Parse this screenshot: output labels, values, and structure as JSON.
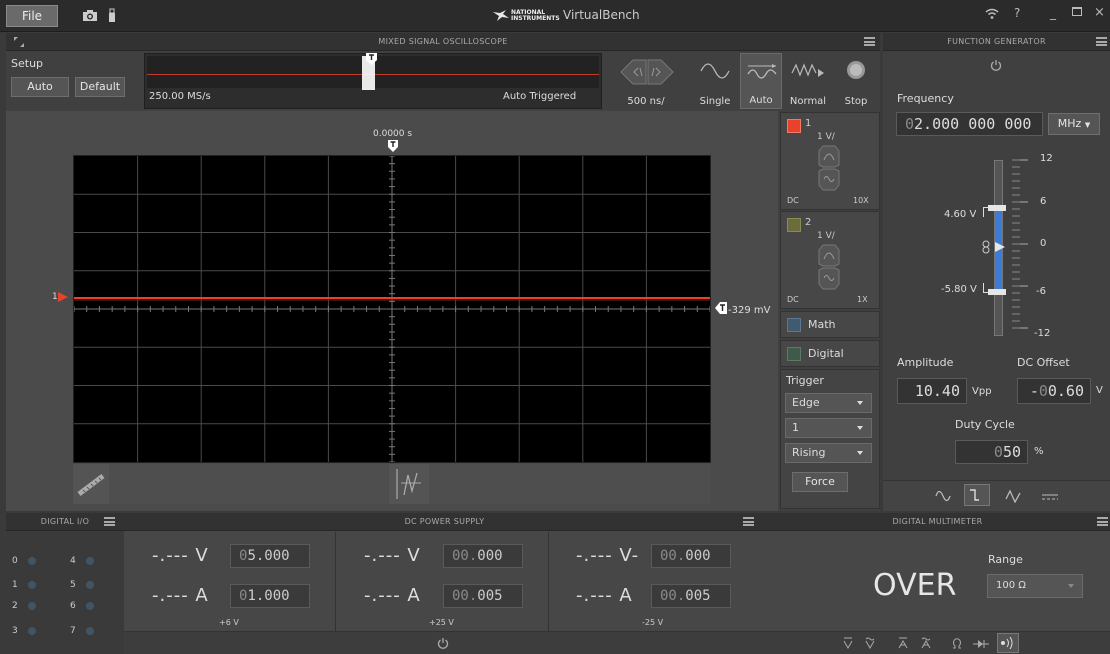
{
  "titlebar": {
    "file_label": "File",
    "app_title": "VirtualBench",
    "logo_text_top": "NATIONAL",
    "logo_text_bottom": "INSTRUMENTS",
    "help": "?",
    "minimize": "_",
    "close": "×"
  },
  "scope": {
    "title": "MIXED SIGNAL OSCILLOSCOPE",
    "setup_label": "Setup",
    "auto_label": "Auto",
    "default_label": "Default",
    "sample_rate": "250.00 MS/s",
    "trigger_status": "Auto Triggered",
    "timebase": "500 ns/",
    "acq_single": "Single",
    "acq_auto": "Auto",
    "acq_normal": "Normal",
    "acq_stop": "Stop",
    "time_offset": "0.0000 s",
    "trigger_level_value": "-329 mV",
    "channel_marker": "1"
  },
  "channels": {
    "ch1": {
      "number": "1",
      "scale": "1 V/",
      "coupling": "DC",
      "probe": "10X",
      "color": "#e8412c"
    },
    "ch2": {
      "number": "2",
      "scale": "1 V/",
      "coupling": "DC",
      "probe": "1X",
      "color": "#6b6b3c"
    },
    "math_label": "Math",
    "digital_label": "Digital"
  },
  "trigger": {
    "title": "Trigger",
    "type": "Edge",
    "source": "1",
    "slope": "Rising",
    "force_label": "Force"
  },
  "fgen": {
    "title": "FUNCTION GENERATOR",
    "frequency_label": "Frequency",
    "frequency_lead": "0",
    "frequency_value": "2.000 000 000",
    "frequency_unit": "MHz",
    "slider_high": "4.60 V",
    "slider_low": "-5.80 V",
    "scale_12": "12",
    "scale_6": "6",
    "scale_0": "0",
    "scale_m6": "-6",
    "scale_m12": "-12",
    "amplitude_label": "Amplitude",
    "amplitude_value": "10.40",
    "amplitude_unit": "Vpp",
    "offset_label": "DC Offset",
    "offset_sign": "-",
    "offset_lead": "0",
    "offset_value": "0.60",
    "offset_unit": "V",
    "duty_label": "Duty Cycle",
    "duty_lead": "0",
    "duty_value": "50",
    "duty_unit": "%"
  },
  "dio": {
    "title": "DIGITAL I/O",
    "left": [
      "0",
      "1",
      "2",
      "3"
    ],
    "right": [
      "4",
      "5",
      "6",
      "7"
    ]
  },
  "dcps": {
    "title": "DC POWER SUPPLY",
    "ch_p6": {
      "v_meas": "-.--- V",
      "v_lead": "0",
      "v_set": "5.000",
      "a_meas": "-.--- A",
      "a_lead": "0",
      "a_set": "1.000",
      "name": "+6 V"
    },
    "ch_p25": {
      "v_meas": "-.--- V",
      "v_lead": "00.",
      "v_set": "000",
      "a_meas": "-.--- A",
      "a_lead": "00.",
      "a_set": "005",
      "name": "+25 V"
    },
    "ch_m25": {
      "v_meas": "-.--- V-",
      "v_lead": "00.",
      "v_set": "000",
      "a_meas": "-.--- A",
      "a_lead": "00.",
      "a_set": "005",
      "name": "-25 V"
    }
  },
  "dmm": {
    "title": "DIGITAL MULTIMETER",
    "reading": "OVER",
    "range_label": "Range",
    "range_value": "100 Ω"
  }
}
